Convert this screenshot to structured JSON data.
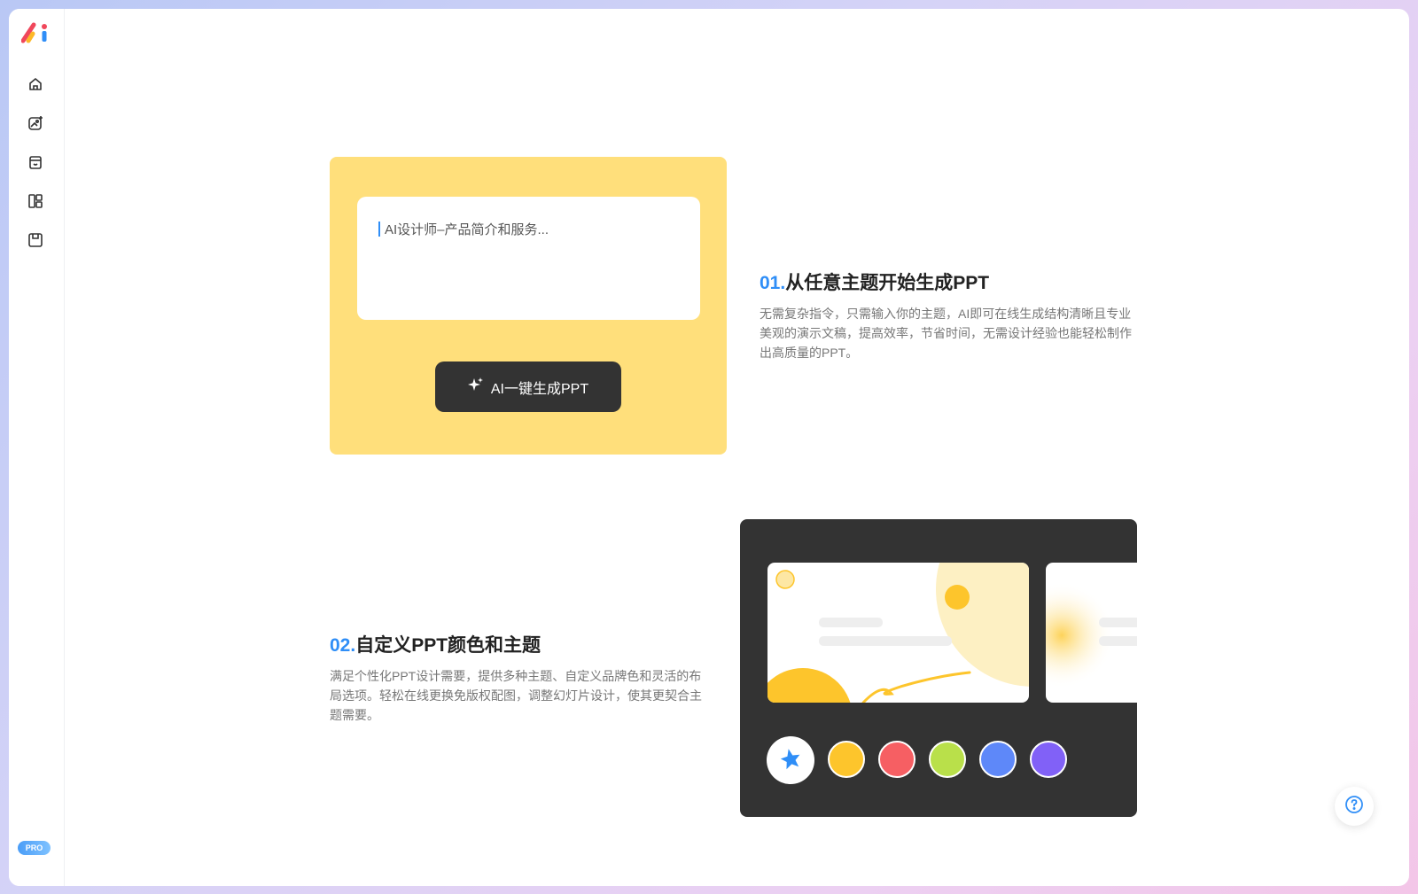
{
  "sidebar": {
    "logo": "ai-logo",
    "items": [
      {
        "icon": "home-icon"
      },
      {
        "icon": "ai-image-icon"
      },
      {
        "icon": "store-icon"
      },
      {
        "icon": "layout-icon"
      },
      {
        "icon": "save-icon"
      }
    ],
    "pro_label": "PRO"
  },
  "feature1": {
    "number": "01.",
    "title": "从任意主题开始生成PPT",
    "description": "无需复杂指令，只需输入你的主题，AI即可在线生成结构清晰且专业美观的演示文稿，提高效率，节省时间，无需设计经验也能轻松制作出高质量的PPT。",
    "prompt_placeholder": "AI设计师–产品简介和服务...",
    "button_label": "AI一键生成PPT"
  },
  "feature2": {
    "number": "02.",
    "title": "自定义PPT颜色和主题",
    "description": "满足个性化PPT设计需要，提供多种主题、自定义品牌色和灵活的布局选项。轻松在线更换免版权配图，调整幻灯片设计，使其更契合主题需要。",
    "swatches": [
      {
        "name": "auto",
        "color": "#ffffff"
      },
      {
        "name": "yellow",
        "color": "#fdc52c"
      },
      {
        "name": "red",
        "color": "#f65f63"
      },
      {
        "name": "green",
        "color": "#b9e04a"
      },
      {
        "name": "blue",
        "color": "#5e88f9"
      },
      {
        "name": "purple",
        "color": "#8161f7"
      }
    ]
  },
  "colors": {
    "accent": "#2f8ef7",
    "card_yellow": "#ffdf7b",
    "card_dark": "#333333"
  },
  "help": {
    "icon": "help-icon"
  }
}
